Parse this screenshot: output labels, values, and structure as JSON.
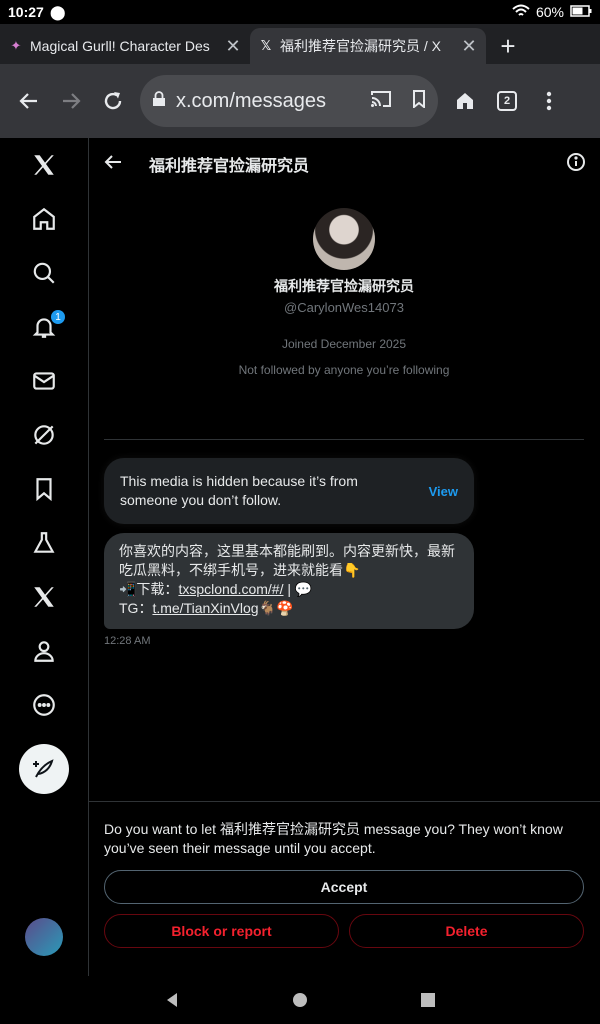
{
  "status": {
    "time": "10:27",
    "battery": "60%"
  },
  "tabs": [
    {
      "title": "Magical Gurll! Character Des",
      "icon": "sparkle-favicon",
      "active": false
    },
    {
      "title": "福利推荐官捡漏研究员 / X",
      "icon": "x-favicon",
      "active": true
    }
  ],
  "browser": {
    "url": "x.com/messages",
    "tab_count": "2"
  },
  "sidebar": {
    "notification_badge": "1"
  },
  "conversation": {
    "header_title": "福利推荐官捡漏研究员",
    "profile": {
      "name": "福利推荐官捡漏研究员",
      "handle": "@CarylonWes14073",
      "joined": "Joined December 2025",
      "following_note": "Not followed by anyone you’re following"
    },
    "hidden_media": {
      "text": "This media is hidden because it’s from someone you don’t follow.",
      "view_label": "View"
    },
    "message": {
      "line1": "你喜欢的内容，这里基本都能刷到。内容更新快，最新吃瓜黑料，不绑手机号，进来就能看👇",
      "line2_prefix": "📲下载：",
      "line2_link": "txspclond.com/#/",
      "line2_suffix": " | 💬",
      "line3_prefix": "TG：",
      "line3_link": "t.me/TianXinVlog",
      "line3_suffix": "🐐🍄",
      "time": "12:28 AM"
    },
    "request": {
      "question": "Do you want to let 福利推荐官捡漏研究员 message you? They won’t know you’ve seen their message until you accept.",
      "accept_label": "Accept",
      "block_label": "Block or report",
      "delete_label": "Delete"
    }
  }
}
